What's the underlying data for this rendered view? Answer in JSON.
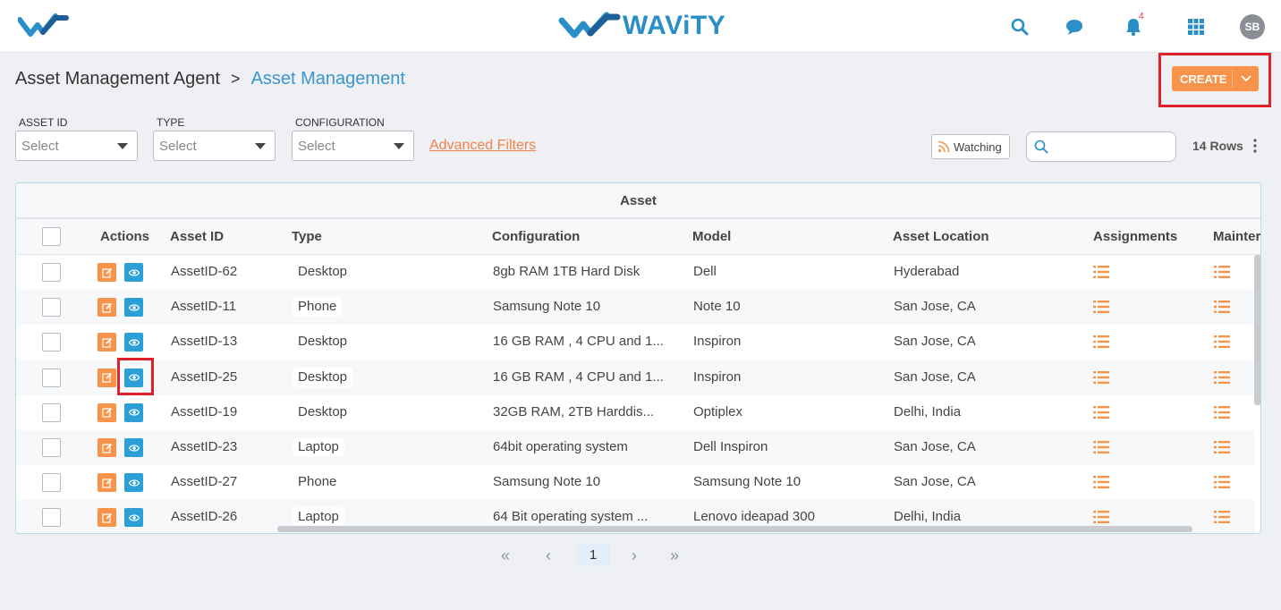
{
  "header": {
    "brand_text": "WAViTY",
    "notification_count": "4",
    "avatar_initials": "SB",
    "colors": {
      "brand": "#2a8ec9",
      "accent": "#f7934a",
      "highlight": "#e0202a"
    }
  },
  "breadcrumb": {
    "root": "Asset Management Agent",
    "separator": ">",
    "current": "Asset Management"
  },
  "toolbar": {
    "create_label": "CREATE",
    "watching_label": "Watching",
    "search_placeholder": "",
    "rows_label": "14 Rows",
    "advanced_filters_label": "Advanced Filters"
  },
  "filters": [
    {
      "label": "ASSET ID",
      "placeholder": "Select"
    },
    {
      "label": "TYPE",
      "placeholder": "Select"
    },
    {
      "label": "CONFIGURATION",
      "placeholder": "Select"
    }
  ],
  "table": {
    "group_header": "Asset",
    "columns": [
      "Actions",
      "Asset ID",
      "Type",
      "Configuration",
      "Model",
      "Asset Location",
      "Assignments",
      "Mainter"
    ],
    "rows": [
      {
        "asset_id": "AssetID-62",
        "type": "Desktop",
        "configuration": "8gb RAM 1TB Hard Disk",
        "model": "Dell",
        "location": "Hyderabad"
      },
      {
        "asset_id": "AssetID-11",
        "type": "Phone",
        "configuration": "Samsung Note 10",
        "model": "Note 10",
        "location": "San Jose, CA"
      },
      {
        "asset_id": "AssetID-13",
        "type": "Desktop",
        "configuration": "16 GB RAM , 4 CPU and 1...",
        "model": "Inspiron",
        "location": "San Jose, CA"
      },
      {
        "asset_id": "AssetID-25",
        "type": "Desktop",
        "configuration": "16 GB RAM , 4 CPU and 1...",
        "model": "Inspiron",
        "location": "San Jose, CA"
      },
      {
        "asset_id": "AssetID-19",
        "type": "Desktop",
        "configuration": "32GB RAM, 2TB Harddis...",
        "model": "Optiplex",
        "location": "Delhi, India"
      },
      {
        "asset_id": "AssetID-23",
        "type": "Laptop",
        "configuration": "64bit operating system",
        "model": "Dell Inspiron",
        "location": "San Jose, CA"
      },
      {
        "asset_id": "AssetID-27",
        "type": "Phone",
        "configuration": "Samsung Note 10",
        "model": "Samsung Note 10",
        "location": "San Jose, CA"
      },
      {
        "asset_id": "AssetID-26",
        "type": "Laptop",
        "configuration": "64 Bit operating system ...",
        "model": "Lenovo ideapad 300",
        "location": "Delhi, India"
      }
    ]
  },
  "pagination": {
    "first": "«",
    "prev": "‹",
    "current_page": "1",
    "next": "›",
    "last": "»"
  }
}
